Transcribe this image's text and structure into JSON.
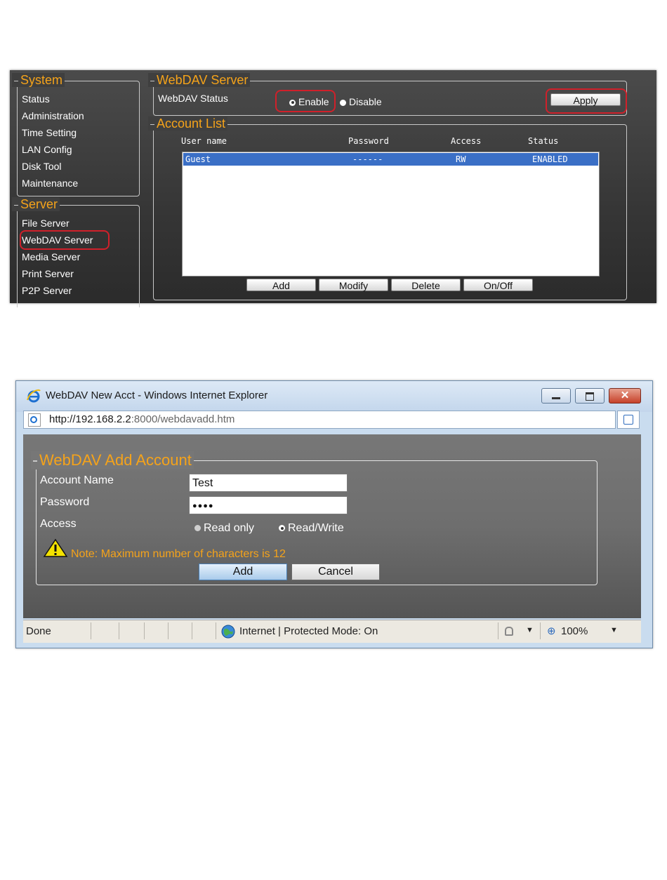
{
  "panel1": {
    "system_legend": "System",
    "system_items": [
      "Status",
      "Administration",
      "Time Setting",
      "LAN Config",
      "Disk Tool",
      "Maintenance"
    ],
    "server_legend": "Server",
    "server_items": [
      "File Server",
      "WebDAV Server",
      "Media Server",
      "Print Server",
      "P2P Server"
    ],
    "webdav_legend": "WebDAV Server",
    "status_label": "WebDAV Status",
    "enable_label": "Enable",
    "disable_label": "Disable",
    "apply_label": "Apply",
    "account_legend": "Account List",
    "columns": [
      "User name",
      "Password",
      "Access",
      "Status"
    ],
    "rows": [
      {
        "user": "Guest",
        "password": "------",
        "access": "RW",
        "status": "ENABLED"
      }
    ],
    "buttons": [
      "Add",
      "Modify",
      "Delete",
      "On/Off"
    ]
  },
  "ie": {
    "title": "WebDAV New Acct - Windows Internet Explorer",
    "url_host": "http://192.168.2.2",
    "url_rest": ":8000/webdavadd.htm",
    "legend": "WebDAV Add Account",
    "account_name_label": "Account Name",
    "account_name_value": "Test",
    "password_label": "Password",
    "password_value": "●●●●",
    "access_label": "Access",
    "read_only_label": "Read only",
    "read_write_label": "Read/Write",
    "note": "Note: Maximum number of characters is 12",
    "add_label": "Add",
    "cancel_label": "Cancel",
    "status_done": "Done",
    "status_zone": "Internet | Protected Mode: On",
    "zoom": "100%"
  },
  "colors": {
    "accent": "#f5a31a",
    "highlight": "#d0202a",
    "selection": "#3a6fc6"
  }
}
